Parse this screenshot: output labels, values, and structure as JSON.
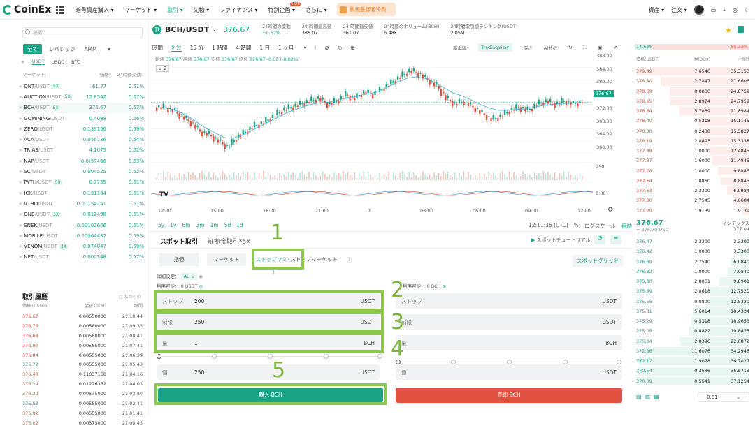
{
  "nav": {
    "logo": "CoinEx",
    "menu": [
      "暗号資産購入",
      "マーケット",
      "取引",
      "先物",
      "ファイナンス",
      "特別企画",
      "さらに"
    ],
    "hot": "HOT",
    "promo": "新規登録者特典",
    "assets": "資産",
    "orders": "注文"
  },
  "colors": {
    "accent": "#1aa385",
    "sell": "#e0513f",
    "highlight": "#8dc74f"
  },
  "sidebar": {
    "search_placeholder": "検索",
    "tabs": [
      "全て",
      "レバレッジ",
      "AMM"
    ],
    "quote_tabs": [
      "USDT",
      "USDC",
      "BTC"
    ],
    "headers": [
      "マーケット:",
      "価格:",
      "24時間変動:"
    ],
    "markets": [
      {
        "base": "QNT",
        "quote": "/USDT",
        "lev": "5X",
        "price": "61.77",
        "change": "0.61%"
      },
      {
        "base": "AUCTION",
        "quote": "/USDT",
        "lev": "5X",
        "price": "12.8542",
        "change": "0.67%"
      },
      {
        "base": "BCH",
        "quote": "/USDT",
        "lev": "5X",
        "price": "376.67",
        "change": "0.67%"
      },
      {
        "base": "GOMINING",
        "quote": "/USDT",
        "lev": "",
        "price": "0.4098",
        "change": "0.66%"
      },
      {
        "base": "ZERO",
        "quote": "/USDT",
        "lev": "",
        "price": "0.139156",
        "change": "0.59%"
      },
      {
        "base": "ACA",
        "quote": "/USDT",
        "lev": "",
        "price": "0.056736",
        "change": "0.64%"
      },
      {
        "base": "TRIAS",
        "quote": "/USDT",
        "lev": "",
        "price": "4.1075",
        "change": "0.62%"
      },
      {
        "base": "NAP",
        "quote": "/USDT",
        "lev": "",
        "price": "0.0₂57466",
        "change": "0.63%"
      },
      {
        "base": "SC",
        "quote": "/USDT",
        "lev": "",
        "price": "0.004525",
        "change": "0.62%"
      },
      {
        "base": "PYTH",
        "quote": "/USDT",
        "lev": "5X",
        "price": "0.3755",
        "change": "0.61%"
      },
      {
        "base": "ICX",
        "quote": "/USDT",
        "lev": "",
        "price": "0.131304",
        "change": "0.61%"
      },
      {
        "base": "VTHO",
        "quote": "/USDT",
        "lev": "",
        "price": "0.00154251",
        "change": "0.61%"
      },
      {
        "base": "ONE",
        "quote": "/USDT",
        "lev": "3X",
        "price": "0.012498",
        "change": "0.61%"
      },
      {
        "base": "SNEK",
        "quote": "/USDT",
        "lev": "",
        "price": "0.00102646",
        "change": "0.61%"
      },
      {
        "base": "MOBILE",
        "quote": "/USDT",
        "lev": "",
        "price": "0.00064482",
        "change": "0.59%"
      },
      {
        "base": "VENOM",
        "quote": "/USDT",
        "lev": "3X",
        "price": "0.074847",
        "change": "0.59%"
      },
      {
        "base": "NET",
        "quote": "/USDT",
        "lev": "",
        "price": "0.000348",
        "change": "0.57%"
      }
    ],
    "trades_title": "取引履歴",
    "trades_mine": "私のもの",
    "trades_headers": [
      "価格 (USDT)",
      "金額 (BCH)",
      "時間"
    ],
    "trades": [
      {
        "p": "376.67",
        "a": "0.00550000",
        "t": "21:10:44",
        "side": "sell"
      },
      {
        "p": "376.75",
        "a": "0.00560000",
        "t": "21:09:35",
        "side": "sell"
      },
      {
        "p": "376.68",
        "a": "0.00560000",
        "t": "21:08:41",
        "side": "sell"
      },
      {
        "p": "376.87",
        "a": "0.00565000",
        "t": "21:07:41",
        "side": "sell"
      },
      {
        "p": "376.84",
        "a": "0.00555000",
        "t": "21:06:39",
        "side": "sell"
      },
      {
        "p": "376.72",
        "a": "0.00555000",
        "t": "21:05:43",
        "side": "buy"
      },
      {
        "p": "376.48",
        "a": "0.11037168",
        "t": "21:04:16",
        "side": "sell"
      },
      {
        "p": "376.34",
        "a": "0.01226352",
        "t": "21:04:03",
        "side": "sell"
      },
      {
        "p": "376.32",
        "a": "0.00575000",
        "t": "21:03:40",
        "side": "sell"
      },
      {
        "p": "376.58",
        "a": "0.00585000",
        "t": "21:02:41",
        "side": "buy"
      },
      {
        "p": "375.92",
        "a": "0.00555000",
        "t": "21:01:41",
        "side": "sell"
      },
      {
        "p": "375.02",
        "a": "0.00575000",
        "t": "21:00:45",
        "side": "sell"
      }
    ]
  },
  "pair": {
    "name": "BCH/USDT",
    "price": "376.67",
    "stats": [
      {
        "label": "24時間の変動",
        "value": "+0.67%"
      },
      {
        "label": "24 時間最高値",
        "value": "386.07"
      },
      {
        "label": "24 時間最安値",
        "value": "361.07"
      },
      {
        "label": "24時間のボリューム(BCH)",
        "value": "5.48K"
      },
      {
        "label": "24時間取引額ランキング(USDT)",
        "value": "2.05M"
      }
    ]
  },
  "chart": {
    "intervals": [
      "時間",
      "5 分",
      "15 分",
      "1 時間",
      "4 時間",
      "1 日",
      "1 ヶ月"
    ],
    "views": [
      "基本版",
      "TradingView",
      "深さ",
      "AI分析"
    ],
    "ohlc": {
      "o_l": "始値",
      "o": "376.67",
      "h_l": "高値",
      "h": "376.67",
      "l_l": "安値",
      "l": "376.67",
      "c_l": "終値",
      "c": "376.67",
      "chg": "-0.08 (-0.02%)"
    },
    "zoom": "2",
    "price_ticks": [
      "388.00",
      "384.00",
      "380.00",
      "376.00",
      "372.00",
      "368.00",
      "364.00",
      "360.00"
    ],
    "last_price": "376.67",
    "vol_tick": "250",
    "osc_tick": "0.00",
    "time_ticks": [
      "12:00",
      "15:00",
      "18:00",
      "21:00",
      "7",
      "03:00",
      "06:00",
      "09:00",
      "12:00"
    ],
    "ranges": [
      "5y",
      "1y",
      "6m",
      "3m",
      "1m",
      "5d",
      "1d"
    ],
    "clock": "12:11:36 (UTC)",
    "pct": "%",
    "log": "ログスケール",
    "auto": "自動"
  },
  "chart_data": {
    "type": "candlestick",
    "title": "BCH/USDT",
    "x_ticks": [
      "12:00",
      "15:00",
      "18:00",
      "21:00",
      "7",
      "03:00",
      "06:00",
      "09:00",
      "12:00"
    ],
    "ylim": [
      358,
      390
    ],
    "close": [
      375,
      374,
      372,
      370,
      367,
      366,
      364,
      362,
      365,
      367,
      369,
      370,
      372,
      374,
      375,
      376,
      377,
      378,
      376,
      377,
      379,
      378,
      380,
      379,
      381,
      383,
      385,
      387,
      386,
      384,
      382,
      378,
      376,
      377,
      375,
      373,
      371,
      372,
      374,
      375,
      374,
      376,
      377,
      376,
      377,
      376,
      377
    ],
    "ma": [
      375,
      374.5,
      373.5,
      372,
      370,
      368,
      366.5,
      365,
      365,
      366,
      367.5,
      369,
      370.5,
      372,
      373.5,
      374.5,
      375.5,
      376.3,
      376.5,
      377,
      377.8,
      378.3,
      379,
      379.5,
      380.5,
      381.8,
      383.2,
      384.5,
      385,
      384.5,
      383.3,
      381.5,
      379.8,
      378.8,
      377.5,
      376,
      374.8,
      374,
      374,
      374.3,
      374.5,
      375,
      375.6,
      375.9,
      376.3,
      376.3,
      376.6
    ]
  },
  "order": {
    "tabs": [
      "スポット取引",
      "証拠金取引*5X"
    ],
    "tutorial": "スポットチュートリアル",
    "types": [
      "指値",
      "マーケット",
      "ストップリミット",
      "ストップマーケット"
    ],
    "grid": "スポットグリッド",
    "settings_label": "詳細設定：",
    "settings_val": "AL",
    "avail_buy": "利用可能： 0 USDT",
    "avail_sell": "利用可能： 0 BCH",
    "buy": {
      "stop_label": "ストップ",
      "stop": "200",
      "stop_unit": "USDT",
      "limit_label": "制限",
      "limit": "250",
      "limit_unit": "USDT",
      "amount_label": "量",
      "amount": "1",
      "amount_unit": "BCH",
      "total_label": "値",
      "total": "250",
      "total_unit": "USDT",
      "button": "購入 BCH"
    },
    "sell": {
      "stop_label": "ストップ",
      "stop_unit": "USDT",
      "limit_label": "制限",
      "limit_unit": "USDT",
      "amount_label": "量",
      "amount_unit": "BCH",
      "total_label": "値",
      "total_unit": "USDT",
      "button": "売却 BCH"
    },
    "steps": [
      "1",
      "2",
      "3",
      "4",
      "5"
    ]
  },
  "orderbook": {
    "buy_pct": "14.67%",
    "sell_pct": "85.33%",
    "headers": [
      "価格(USDT)",
      "量(BCH)",
      "合計"
    ],
    "asks": [
      [
        "379.49",
        "7.6546",
        "35.3153"
      ],
      [
        "378.90",
        "2.7847",
        "27.6606"
      ],
      [
        "378.69",
        "0.0800",
        "24.8759"
      ],
      [
        "378.65",
        "2.8974",
        "24.7959"
      ],
      [
        "378.64",
        "5.7839",
        "21.8984"
      ],
      [
        "378.40",
        "0.5318",
        "16.1145"
      ],
      [
        "378.30",
        "0.2488",
        "15.5827"
      ],
      [
        "378.19",
        "2.8493",
        "15.3338"
      ],
      [
        "377.88",
        "1.0000",
        "12.4845"
      ],
      [
        "377.87",
        "1.6000",
        "11.4845"
      ],
      [
        "377.78",
        "1.0000",
        "9.8845"
      ],
      [
        "377.64",
        "1.8860",
        "8.8845"
      ],
      [
        "377.63",
        "2.3300",
        "6.9984"
      ],
      [
        "377.30",
        "2.7545",
        "4.6684"
      ],
      [
        "377.29",
        "1.9139",
        "1.9139"
      ]
    ],
    "mid_price": "376.67",
    "mid_usd": "≈ 376.70 USD",
    "index_label": "インデックス",
    "index": "377.04",
    "bids": [
      [
        "376.47",
        "2.3300",
        "2.3300"
      ],
      [
        "376.42",
        "1.0000",
        "3.3300"
      ],
      [
        "376.39",
        "2.7540",
        "6.0840"
      ],
      [
        "376.32",
        "1.0000",
        "7.0840"
      ],
      [
        "375.80",
        "2.8061",
        "9.8901"
      ],
      [
        "375.59",
        "2.8618",
        "12.7520"
      ],
      [
        "375.55",
        "0.0800",
        "12.8320"
      ],
      [
        "375.31",
        "5.6014",
        "18.4334"
      ],
      [
        "375.29",
        "0.5318",
        "18.9653"
      ],
      [
        "375.05",
        "0.8822",
        "19.8475"
      ],
      [
        "375.04",
        "2.8396",
        "22.6872"
      ],
      [
        "372.36",
        "11.6076",
        "34.2948"
      ],
      [
        "372.17",
        "1.9078",
        "36.2027"
      ],
      [
        "370.54",
        "0.3686",
        "36.5713"
      ],
      [
        "370.09",
        "0.5541",
        "37.1254"
      ]
    ],
    "tick": "0.01"
  }
}
